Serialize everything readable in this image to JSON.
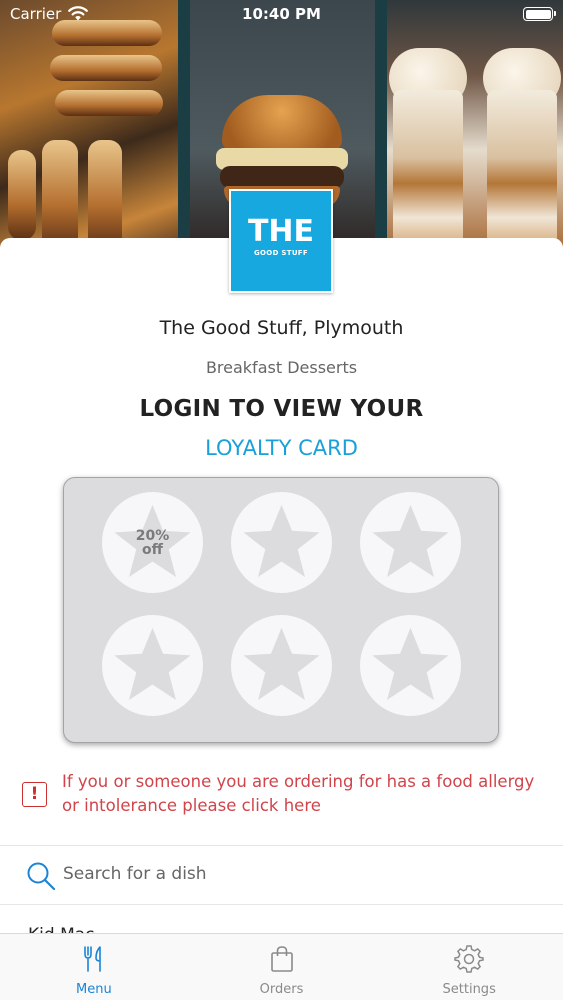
{
  "status_bar": {
    "carrier": "Carrier",
    "time": "10:40 PM"
  },
  "restaurant": {
    "logo_line1": "THE",
    "logo_line2": "GOOD STUFF",
    "name": "The Good Stuff, Plymouth",
    "tags": "Breakfast Desserts"
  },
  "loyalty": {
    "title": "LOGIN TO VIEW YOUR",
    "link": "LOYALTY CARD",
    "stamps": [
      {
        "reward_line1": "20%",
        "reward_line2": "off"
      },
      {
        "reward_line1": "",
        "reward_line2": ""
      },
      {
        "reward_line1": "",
        "reward_line2": ""
      },
      {
        "reward_line1": "",
        "reward_line2": ""
      },
      {
        "reward_line1": "",
        "reward_line2": ""
      },
      {
        "reward_line1": "",
        "reward_line2": ""
      }
    ]
  },
  "allergy": {
    "text": "If you or someone you are ordering for has a food allergy or intolerance please click here"
  },
  "search": {
    "placeholder": "Search for a dish"
  },
  "menu": {
    "partial_item": "Kid Mac"
  },
  "tabs": [
    {
      "label": "Menu",
      "icon": "fork-knife-icon",
      "active": true
    },
    {
      "label": "Orders",
      "icon": "shopping-bag-icon",
      "active": false
    },
    {
      "label": "Settings",
      "icon": "gear-icon",
      "active": false
    }
  ],
  "colors": {
    "accent": "#1aa0d8",
    "brand": "#17a8df",
    "alert": "#d0444a",
    "tab_active": "#1a85d6"
  }
}
